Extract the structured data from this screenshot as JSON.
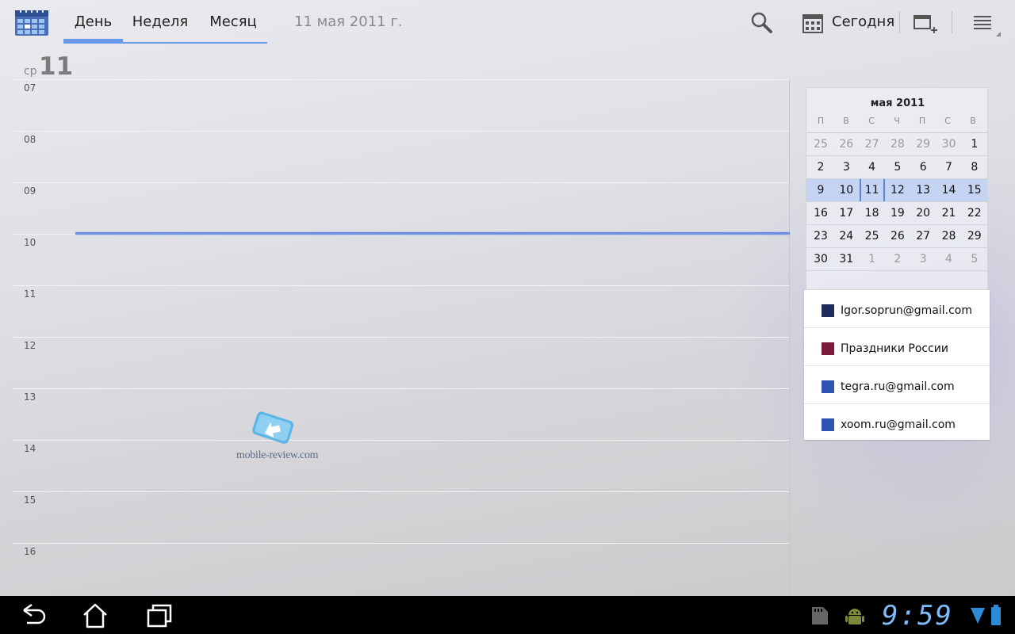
{
  "actionbar": {
    "tabs": [
      {
        "label": "День",
        "active": true
      },
      {
        "label": "Неделя",
        "active": false
      },
      {
        "label": "Месяц",
        "active": false
      }
    ],
    "date_label": "11 мая 2011 г.",
    "today_label": "Сегодня",
    "icons": [
      "calendar-app-icon",
      "search-icon",
      "today-calendar-icon",
      "new-event-icon",
      "menu-icon"
    ]
  },
  "day_header": {
    "dow": "ср",
    "day": "11"
  },
  "hours": [
    "07",
    "08",
    "09",
    "10",
    "11",
    "12",
    "13",
    "14",
    "15",
    "16"
  ],
  "watermark": {
    "text": "mobile-review.com"
  },
  "minimonth": {
    "title": "мая 2011",
    "dow": [
      "П",
      "В",
      "С",
      "Ч",
      "П",
      "С",
      "В"
    ],
    "weeks": [
      [
        "25",
        "26",
        "27",
        "28",
        "29",
        "30",
        "1"
      ],
      [
        "2",
        "3",
        "4",
        "5",
        "6",
        "7",
        "8"
      ],
      [
        "9",
        "10",
        "11",
        "12",
        "13",
        "14",
        "15"
      ],
      [
        "16",
        "17",
        "18",
        "19",
        "20",
        "21",
        "22"
      ],
      [
        "23",
        "24",
        "25",
        "26",
        "27",
        "28",
        "29"
      ],
      [
        "30",
        "31",
        "1",
        "2",
        "3",
        "4",
        "5"
      ]
    ],
    "selected_week": 2,
    "today": "11"
  },
  "calendars": [
    {
      "name": "Igor.soprun@gmail.com",
      "color": "#1f2b5a",
      "bold": true
    },
    {
      "name": "Праздники России",
      "color": "#7a1c3a",
      "bold": false
    },
    {
      "name": "tegra.ru@gmail.com",
      "color": "#2f55b4",
      "bold": true
    },
    {
      "name": "xoom.ru@gmail.com",
      "color": "#2f55b4",
      "bold": true
    }
  ],
  "system_bar": {
    "clock": "9:59",
    "icons": [
      "back-icon",
      "home-icon",
      "recent-apps-icon",
      "sd-card-icon",
      "android-debug-icon",
      "wifi-icon",
      "battery-icon"
    ],
    "accent": "#7dbdfc"
  }
}
